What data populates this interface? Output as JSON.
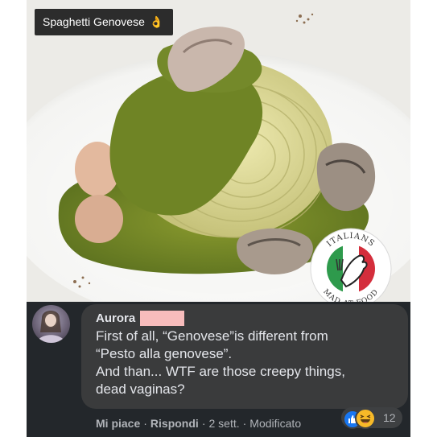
{
  "post": {
    "caption": "Spaghetti Genovese",
    "caption_emoji": "👌",
    "badge": {
      "top_text": "ITALIANS",
      "bottom_text": "MAD AT FOOD"
    }
  },
  "comment": {
    "author": "Aurora",
    "lines": [
      "First of all, “Genovese”is different from",
      "“Pesto alla genovese”.",
      "And than... WTF are those creepy things,",
      "dead vaginas?"
    ],
    "actions": {
      "like": "Mi piace",
      "sep1": "·",
      "reply": "Rispondi",
      "sep2": "·",
      "time": "2 sett.",
      "sep3": "·",
      "edited": "Modificato"
    },
    "reactions": {
      "types": [
        "like-icon",
        "haha-icon"
      ],
      "count": "12"
    }
  },
  "colors": {
    "panel_bg": "#23272b",
    "bubble_bg": "#3a3b3c",
    "text": "#e4e6eb",
    "muted": "#b0b3b8",
    "like_blue": "#1877f2",
    "haha_yellow": "#f7b928",
    "pesto_green": "#7d8f2a"
  }
}
